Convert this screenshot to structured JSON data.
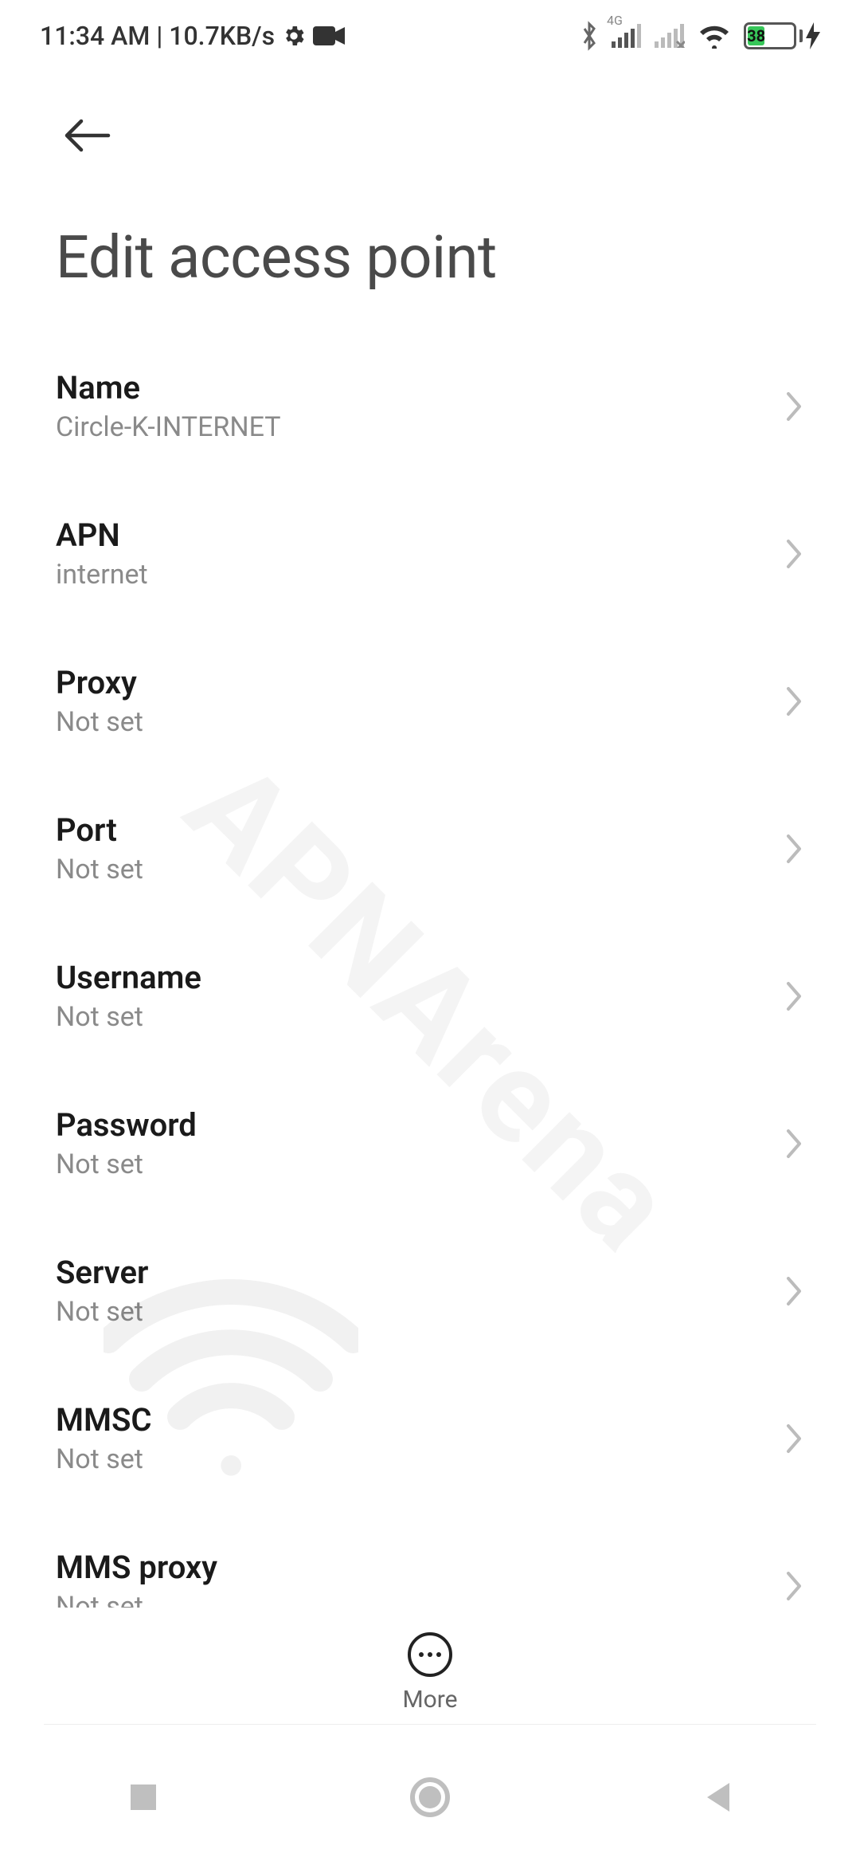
{
  "status": {
    "time": "11:34 AM",
    "separator": "|",
    "net_speed": "10.7KB/s",
    "signal_label": "4G",
    "battery_percent": "38"
  },
  "page": {
    "title": "Edit access point"
  },
  "fields": [
    {
      "label": "Name",
      "value": "Circle-K-INTERNET"
    },
    {
      "label": "APN",
      "value": "internet"
    },
    {
      "label": "Proxy",
      "value": "Not set"
    },
    {
      "label": "Port",
      "value": "Not set"
    },
    {
      "label": "Username",
      "value": "Not set"
    },
    {
      "label": "Password",
      "value": "Not set"
    },
    {
      "label": "Server",
      "value": "Not set"
    },
    {
      "label": "MMSC",
      "value": "Not set"
    },
    {
      "label": "MMS proxy",
      "value": "Not set"
    }
  ],
  "bottom": {
    "more_label": "More"
  },
  "watermark": {
    "text": "APNArena"
  }
}
